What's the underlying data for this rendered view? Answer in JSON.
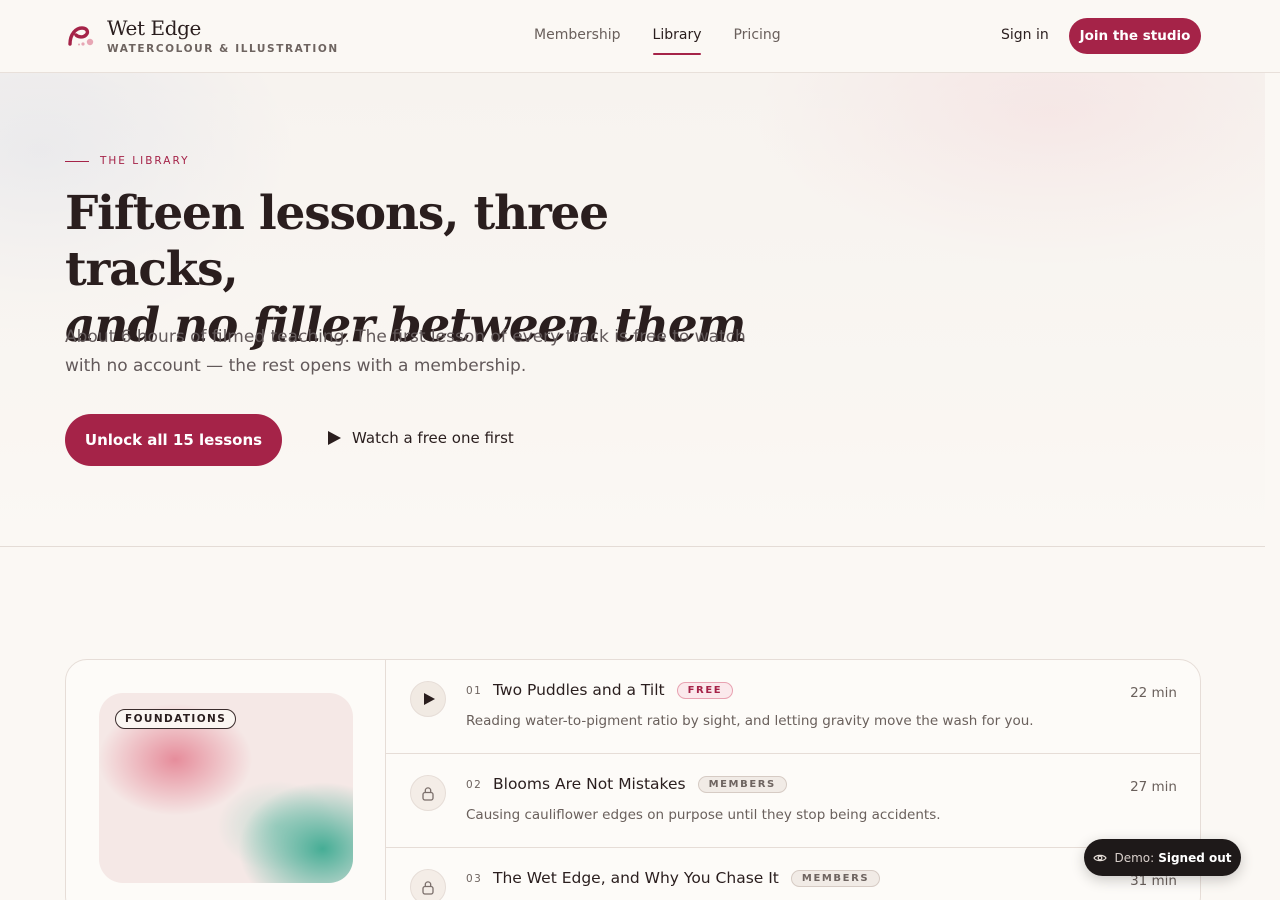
{
  "brand": {
    "name": "Wet Edge",
    "tagline": "WATERCOLOUR & ILLUSTRATION"
  },
  "nav": {
    "items": [
      {
        "label": "Membership",
        "active": false
      },
      {
        "label": "Library",
        "active": true
      },
      {
        "label": "Pricing",
        "active": false
      }
    ],
    "signin": "Sign in",
    "join": "Join the studio"
  },
  "hero": {
    "eyebrow": "THE LIBRARY",
    "title_line1": "Fifteen lessons, three tracks,",
    "title_line2": "and no filler between them",
    "lead": "About 6 hours of filmed teaching. The first lesson of every track is free to watch with no account — the rest opens with a membership.",
    "cta_primary": "Unlock all 15 lessons",
    "cta_secondary": "Watch a free one first"
  },
  "track": {
    "tag": "FOUNDATIONS",
    "lessons": [
      {
        "num": "01",
        "title": "Two Puddles and a Tilt",
        "badge": "FREE",
        "desc": "Reading water-to-pigment ratio by sight, and letting gravity move the wash for you.",
        "duration": "22 min",
        "icon": "play-icon"
      },
      {
        "num": "02",
        "title": "Blooms Are Not Mistakes",
        "badge": "MEMBERS",
        "desc": "Causing cauliflower edges on purpose until they stop being accidents.",
        "duration": "27 min",
        "icon": "lock-icon"
      },
      {
        "num": "03",
        "title": "The Wet Edge, and Why You Chase It",
        "badge": "MEMBERS",
        "desc": "",
        "duration": "31 min",
        "icon": "lock-icon"
      }
    ]
  },
  "demo": {
    "label": "Demo:",
    "value": "Signed out"
  },
  "colors": {
    "accent": "#a52348",
    "background": "#fbf8f4",
    "text": "#2a1e1e"
  }
}
